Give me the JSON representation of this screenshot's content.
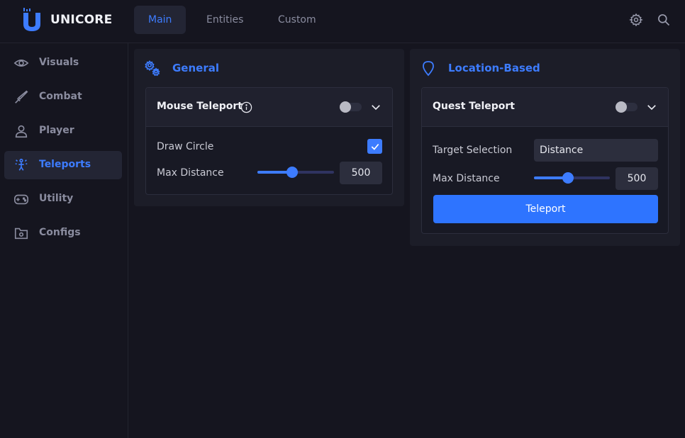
{
  "brand": {
    "name": "UNICORE"
  },
  "header": {
    "tabs": [
      {
        "label": "Main",
        "active": true
      },
      {
        "label": "Entities",
        "active": false
      },
      {
        "label": "Custom",
        "active": false
      }
    ],
    "icons": [
      "gear-icon",
      "search-icon"
    ]
  },
  "sidebar": {
    "items": [
      {
        "label": "Visuals",
        "icon": "eye-icon",
        "active": false
      },
      {
        "label": "Combat",
        "icon": "sword-icon",
        "active": false
      },
      {
        "label": "Player",
        "icon": "user-icon",
        "active": false
      },
      {
        "label": "Teleports",
        "icon": "teleport-icon",
        "active": true
      },
      {
        "label": "Utility",
        "icon": "gamepad-icon",
        "active": false
      },
      {
        "label": "Configs",
        "icon": "folder-gear-icon",
        "active": false
      }
    ]
  },
  "general": {
    "title": "General",
    "icon": "gears-icon",
    "card": {
      "title": "Mouse Teleport",
      "info_icon": "info-icon",
      "toggle_on": false,
      "draw_circle_label": "Draw Circle",
      "draw_circle_checked": true,
      "max_distance_label": "Max Distance",
      "max_distance_value": "500",
      "max_distance_fraction": 0.45
    }
  },
  "location": {
    "title": "Location-Based",
    "icon": "map-pin-icon",
    "card": {
      "title": "Quest Teleport",
      "toggle_on": false,
      "target_selection_label": "Target Selection",
      "target_selection_value": "Distance",
      "max_distance_label": "Max Distance",
      "max_distance_value": "500",
      "max_distance_fraction": 0.45,
      "button_label": "Teleport"
    }
  },
  "colors": {
    "accent": "#3d7cff",
    "background": "#15151f",
    "panel": "#1c1d28"
  }
}
